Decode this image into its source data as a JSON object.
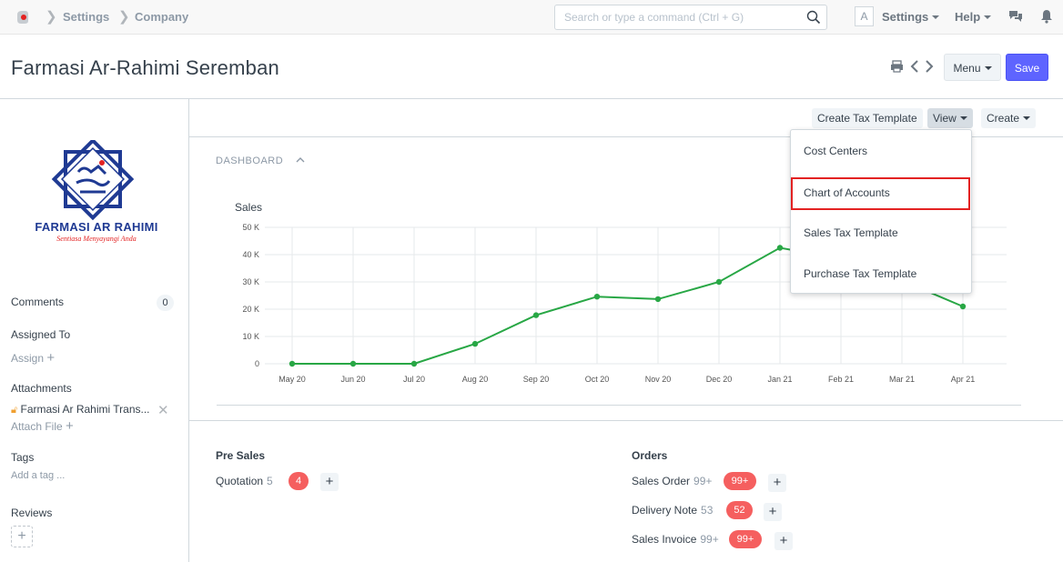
{
  "navbar": {
    "breadcrumbs": [
      "Settings",
      "Company"
    ],
    "search_placeholder": "Search or type a command (Ctrl + G)",
    "avatar_letter": "A",
    "settings_label": "Settings",
    "help_label": "Help"
  },
  "page_head": {
    "title": "Farmasi Ar-Rahimi Seremban",
    "menu_label": "Menu",
    "save_label": "Save"
  },
  "sidebar": {
    "logo_name": "FARMASI AR RAHIMI",
    "logo_tagline": "Sentiasa Menyayangi Anda",
    "comments_label": "Comments",
    "comments_count": "0",
    "assigned_to_label": "Assigned To",
    "assign_label": "Assign",
    "attachments_label": "Attachments",
    "attachment_file": "Farmasi Ar Rahimi Trans...",
    "attach_file_label": "Attach File",
    "tags_label": "Tags",
    "add_tag_label": "Add a tag ...",
    "reviews_label": "Reviews"
  },
  "toolbar": {
    "create_tax_template": "Create Tax Template",
    "view_label": "View",
    "create_label": "Create"
  },
  "dashboard": {
    "label": "DASHBOARD"
  },
  "chart_data": {
    "type": "line",
    "title": "Sales",
    "xlabel": "",
    "ylabel": "",
    "categories": [
      "May 20",
      "Jun 20",
      "Jul 20",
      "Aug 20",
      "Sep 20",
      "Oct 20",
      "Nov 20",
      "Dec 20",
      "Jan 21",
      "Feb 21",
      "Mar 21",
      "Apr 21"
    ],
    "y_ticks": [
      "0",
      "10 K",
      "20 K",
      "30 K",
      "40 K",
      "50 K"
    ],
    "ylim": [
      0,
      50000
    ],
    "series": [
      {
        "values": [
          0,
          0,
          0,
          7300,
          17800,
          24600,
          23700,
          30000,
          42500,
          38500,
          30500,
          21000
        ]
      }
    ],
    "line_color": "#28a745",
    "grid": true
  },
  "pre_sales": {
    "title": "Pre Sales",
    "items": [
      {
        "label": "Quotation",
        "count": "5",
        "badge": "4"
      }
    ]
  },
  "orders": {
    "title": "Orders",
    "items": [
      {
        "label": "Sales Order",
        "count": "99+",
        "badge": "99+"
      },
      {
        "label": "Delivery Note",
        "count": "53",
        "badge": "52"
      },
      {
        "label": "Sales Invoice",
        "count": "99+",
        "badge": "99+"
      }
    ]
  },
  "view_dropdown": {
    "items": [
      "Cost Centers",
      "Chart of Accounts",
      "Sales Tax Template",
      "Purchase Tax Template"
    ]
  },
  "colors": {
    "primary": "#5e64ff",
    "badge_red": "#f55f5f",
    "highlight_border": "#e32222",
    "logo_blue": "#1f3a93"
  }
}
